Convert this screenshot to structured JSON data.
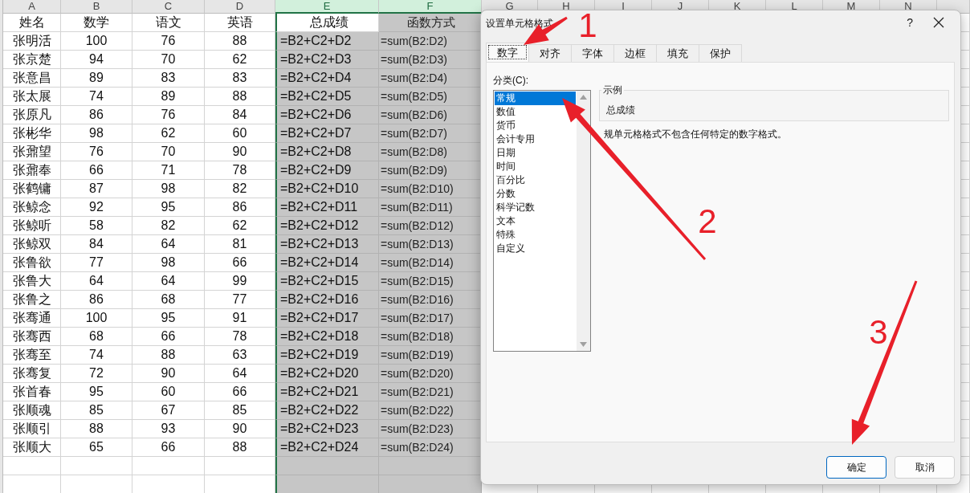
{
  "sheet": {
    "columns": [
      {
        "label": "A",
        "selected": false
      },
      {
        "label": "B",
        "selected": false
      },
      {
        "label": "C",
        "selected": false
      },
      {
        "label": "D",
        "selected": false
      },
      {
        "label": "E",
        "selected": true
      },
      {
        "label": "F",
        "selected": true
      },
      {
        "label": "G",
        "selected": false
      },
      {
        "label": "H",
        "selected": false
      },
      {
        "label": "I",
        "selected": false
      },
      {
        "label": "J",
        "selected": false
      },
      {
        "label": "K",
        "selected": false
      },
      {
        "label": "L",
        "selected": false
      },
      {
        "label": "M",
        "selected": false
      },
      {
        "label": "N",
        "selected": false
      }
    ],
    "rows": [
      [
        "姓名",
        "数学",
        "语文",
        "英语",
        "总成绩",
        "函数方式"
      ],
      [
        "张明活",
        "100",
        "76",
        "88",
        "=B2+C2+D2",
        "=sum(B2:D2)"
      ],
      [
        "张京楚",
        "94",
        "70",
        "62",
        "=B2+C2+D3",
        "=sum(B2:D3)"
      ],
      [
        "张意昌",
        "89",
        "83",
        "83",
        "=B2+C2+D4",
        "=sum(B2:D4)"
      ],
      [
        "张太展",
        "74",
        "89",
        "88",
        "=B2+C2+D5",
        "=sum(B2:D5)"
      ],
      [
        "张原凡",
        "86",
        "76",
        "84",
        "=B2+C2+D6",
        "=sum(B2:D6)"
      ],
      [
        "张彬华",
        "98",
        "62",
        "60",
        "=B2+C2+D7",
        "=sum(B2:D7)"
      ],
      [
        "张鼐望",
        "76",
        "70",
        "90",
        "=B2+C2+D8",
        "=sum(B2:D8)"
      ],
      [
        "张鼐奉",
        "66",
        "71",
        "78",
        "=B2+C2+D9",
        "=sum(B2:D9)"
      ],
      [
        "张鹤镛",
        "87",
        "98",
        "82",
        "=B2+C2+D10",
        "=sum(B2:D10)"
      ],
      [
        "张鲸念",
        "92",
        "95",
        "86",
        "=B2+C2+D11",
        "=sum(B2:D11)"
      ],
      [
        "张鲸听",
        "58",
        "82",
        "62",
        "=B2+C2+D12",
        "=sum(B2:D12)"
      ],
      [
        "张鲸双",
        "84",
        "64",
        "81",
        "=B2+C2+D13",
        "=sum(B2:D13)"
      ],
      [
        "张鲁欲",
        "77",
        "98",
        "66",
        "=B2+C2+D14",
        "=sum(B2:D14)"
      ],
      [
        "张鲁大",
        "64",
        "64",
        "99",
        "=B2+C2+D15",
        "=sum(B2:D15)"
      ],
      [
        "张鲁之",
        "86",
        "68",
        "77",
        "=B2+C2+D16",
        "=sum(B2:D16)"
      ],
      [
        "张骞通",
        "100",
        "95",
        "91",
        "=B2+C2+D17",
        "=sum(B2:D17)"
      ],
      [
        "张骞西",
        "68",
        "66",
        "78",
        "=B2+C2+D18",
        "=sum(B2:D18)"
      ],
      [
        "张骞至",
        "74",
        "88",
        "63",
        "=B2+C2+D19",
        "=sum(B2:D19)"
      ],
      [
        "张骞复",
        "72",
        "90",
        "64",
        "=B2+C2+D20",
        "=sum(B2:D20)"
      ],
      [
        "张首春",
        "95",
        "60",
        "66",
        "=B2+C2+D21",
        "=sum(B2:D21)"
      ],
      [
        "张顺魂",
        "85",
        "67",
        "85",
        "=B2+C2+D22",
        "=sum(B2:D22)"
      ],
      [
        "张顺引",
        "88",
        "93",
        "90",
        "=B2+C2+D23",
        "=sum(B2:D23)"
      ],
      [
        "张顺大",
        "65",
        "66",
        "88",
        "=B2+C2+D24",
        "=sum(B2:D24)"
      ]
    ]
  },
  "dialog": {
    "title": "设置单元格格式",
    "help": "?",
    "tabs": [
      {
        "label": "数字",
        "selected": true
      },
      {
        "label": "对齐",
        "selected": false
      },
      {
        "label": "字体",
        "selected": false
      },
      {
        "label": "边框",
        "selected": false
      },
      {
        "label": "填充",
        "selected": false
      },
      {
        "label": "保护",
        "selected": false
      }
    ],
    "category_label": "分类(C):",
    "categories": [
      {
        "label": "常规",
        "selected": true
      },
      {
        "label": "数值",
        "selected": false
      },
      {
        "label": "货币",
        "selected": false
      },
      {
        "label": "会计专用",
        "selected": false
      },
      {
        "label": "日期",
        "selected": false
      },
      {
        "label": "时间",
        "selected": false
      },
      {
        "label": "百分比",
        "selected": false
      },
      {
        "label": "分数",
        "selected": false
      },
      {
        "label": "科学记数",
        "selected": false
      },
      {
        "label": "文本",
        "selected": false
      },
      {
        "label": "特殊",
        "selected": false
      },
      {
        "label": "自定义",
        "selected": false
      }
    ],
    "sample_label": "示例",
    "sample_value": "总成绩",
    "description": "规单元格格式不包含任何特定的数字格式。",
    "buttons": [
      {
        "label": "确定",
        "default": true
      },
      {
        "label": "取消",
        "default": false
      }
    ]
  },
  "annotations": [
    {
      "label": "1"
    },
    {
      "label": "2"
    },
    {
      "label": "3"
    }
  ]
}
